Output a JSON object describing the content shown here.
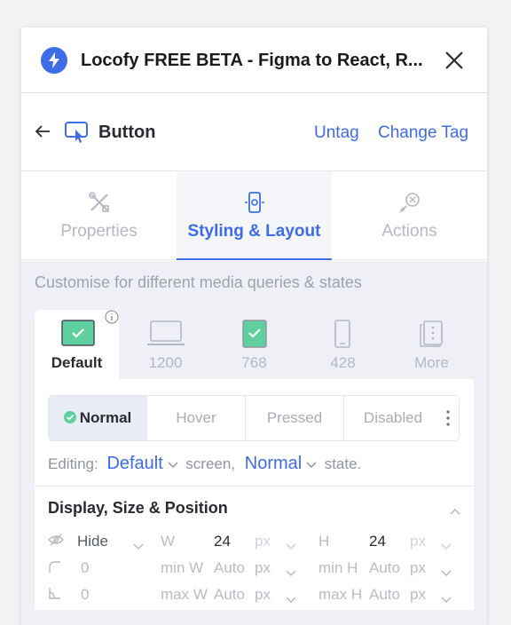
{
  "window": {
    "title": "Locofy FREE BETA - Figma to React, R...",
    "logo_icon": "bolt-icon",
    "close_icon": "close-icon",
    "accent": "#3d6ce6"
  },
  "tag_bar": {
    "tag_name": "Button",
    "untag_label": "Untag",
    "change_tag_label": "Change Tag"
  },
  "tabs": [
    {
      "label": "Properties",
      "icon": "tools-icon",
      "active": false
    },
    {
      "label": "Styling & Layout",
      "icon": "phone-touch-icon",
      "active": true
    },
    {
      "label": "Actions",
      "icon": "cursor-click-icon",
      "active": false
    }
  ],
  "styling": {
    "customise_text": "Customise for different media queries & states",
    "devices": [
      {
        "label": "Default",
        "icon": "desktop-checked-icon",
        "active": true
      },
      {
        "label": "1200",
        "icon": "laptop-icon",
        "active": false
      },
      {
        "label": "768",
        "icon": "tablet-checked-icon",
        "active": false
      },
      {
        "label": "428",
        "icon": "phone-icon",
        "active": false
      },
      {
        "label": "More",
        "icon": "more-icon",
        "active": false
      }
    ],
    "states": [
      {
        "label": "Normal",
        "active": true
      },
      {
        "label": "Hover",
        "active": false
      },
      {
        "label": "Pressed",
        "active": false
      },
      {
        "label": "Disabled",
        "active": false
      }
    ],
    "editing": {
      "prefix": "Editing:",
      "screen_value": "Default",
      "screen_suffix": "screen,",
      "state_value": "Normal",
      "state_suffix": "state."
    }
  },
  "section": {
    "title": "Display, Size & Position",
    "rows": [
      {
        "a_val": "Hide",
        "b_label": "W",
        "b_val": "24",
        "b_unit": "px",
        "c_label": "H",
        "c_val": "24",
        "c_unit": "px"
      },
      {
        "a_val": "0",
        "b_label": "min W",
        "b_val": "Auto",
        "b_unit": "px",
        "c_label": "min H",
        "c_val": "Auto",
        "c_unit": "px"
      },
      {
        "a_val": "0",
        "b_label": "max W",
        "b_val": "Auto",
        "b_unit": "px",
        "c_label": "max H",
        "c_val": "Auto",
        "c_unit": "px"
      }
    ]
  }
}
